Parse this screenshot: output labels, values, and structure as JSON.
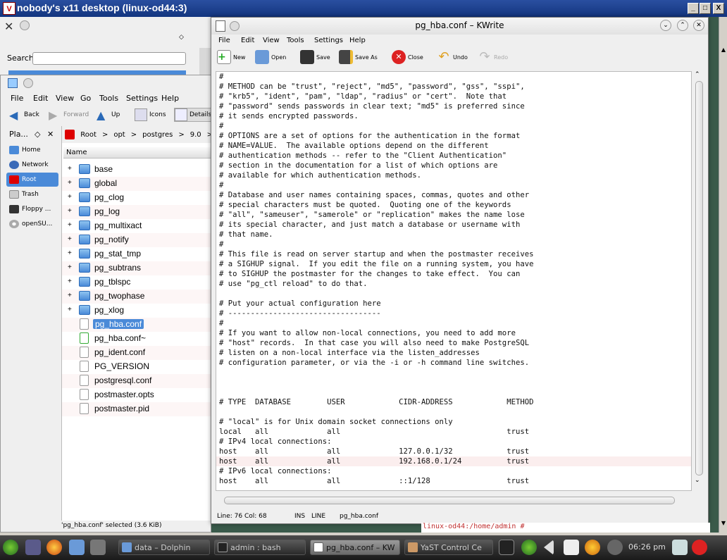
{
  "vnc": {
    "title": "nobody's x11 desktop (linux-od44:3)",
    "logo": "V",
    "minimize": "_",
    "maximize": "□",
    "close": "X"
  },
  "back_window": {
    "search_label": "Search",
    "search_value": ""
  },
  "dolphin": {
    "menu": [
      "File",
      "Edit",
      "View",
      "Go",
      "Tools",
      "Settings",
      "Help"
    ],
    "toolbar": {
      "back": "Back",
      "forward": "Forward",
      "up": "Up",
      "icons": "Icons",
      "details": "Details"
    },
    "places_title": "Pla...",
    "places": [
      {
        "label": "Home",
        "icon": "home-icon"
      },
      {
        "label": "Network",
        "icon": "network-icon"
      },
      {
        "label": "Root",
        "icon": "root-folder-icon",
        "selected": true
      },
      {
        "label": "Trash",
        "icon": "trash-icon"
      },
      {
        "label": "Floppy ...",
        "icon": "floppy-icon"
      },
      {
        "label": "openSU...",
        "icon": "disc-icon"
      }
    ],
    "breadcrumb": [
      "Root",
      "opt",
      "postgres",
      "9.0"
    ],
    "column_header": "Name",
    "files": [
      {
        "name": "base",
        "type": "folder",
        "expand": "+"
      },
      {
        "name": "global",
        "type": "folder",
        "expand": "+"
      },
      {
        "name": "pg_clog",
        "type": "folder",
        "expand": "+"
      },
      {
        "name": "pg_log",
        "type": "folder",
        "expand": "+"
      },
      {
        "name": "pg_multixact",
        "type": "folder",
        "expand": "+"
      },
      {
        "name": "pg_notify",
        "type": "folder",
        "expand": "+"
      },
      {
        "name": "pg_stat_tmp",
        "type": "folder",
        "expand": "+"
      },
      {
        "name": "pg_subtrans",
        "type": "folder",
        "expand": "+"
      },
      {
        "name": "pg_tblspc",
        "type": "folder",
        "expand": "+"
      },
      {
        "name": "pg_twophase",
        "type": "folder",
        "expand": "+"
      },
      {
        "name": "pg_xlog",
        "type": "folder",
        "expand": "+"
      },
      {
        "name": "pg_hba.conf",
        "type": "doc",
        "expand": "",
        "selected": true
      },
      {
        "name": "pg_hba.conf~",
        "type": "doc2",
        "expand": ""
      },
      {
        "name": "pg_ident.conf",
        "type": "doc",
        "expand": ""
      },
      {
        "name": "PG_VERSION",
        "type": "doc",
        "expand": ""
      },
      {
        "name": "postgresql.conf",
        "type": "doc",
        "expand": ""
      },
      {
        "name": "postmaster.opts",
        "type": "doc",
        "expand": ""
      },
      {
        "name": "postmaster.pid",
        "type": "doc",
        "expand": ""
      }
    ],
    "status": "'pg_hba.conf' selected (3.6 KiB)"
  },
  "kwrite": {
    "title": "pg_hba.conf – KWrite",
    "menu": [
      "File",
      "Edit",
      "View",
      "Tools",
      "Settings",
      "Help"
    ],
    "toolbar": {
      "new": "New",
      "open": "Open",
      "save": "Save",
      "save_as": "Save As",
      "close": "Close",
      "undo": "Undo",
      "redo": "Redo"
    },
    "content": "#\n# METHOD can be \"trust\", \"reject\", \"md5\", \"password\", \"gss\", \"sspi\",\n# \"krb5\", \"ident\", \"pam\", \"ldap\", \"radius\" or \"cert\".  Note that\n# \"password\" sends passwords in clear text; \"md5\" is preferred since\n# it sends encrypted passwords.\n#\n# OPTIONS are a set of options for the authentication in the format\n# NAME=VALUE.  The available options depend on the different\n# authentication methods -- refer to the \"Client Authentication\"\n# section in the documentation for a list of which options are\n# available for which authentication methods.\n#\n# Database and user names containing spaces, commas, quotes and other\n# special characters must be quoted.  Quoting one of the keywords\n# \"all\", \"sameuser\", \"samerole\" or \"replication\" makes the name lose\n# its special character, and just match a database or username with\n# that name.\n#\n# This file is read on server startup and when the postmaster receives\n# a SIGHUP signal.  If you edit the file on a running system, you have\n# to SIGHUP the postmaster for the changes to take effect.  You can\n# use \"pg_ctl reload\" to do that.\n\n# Put your actual configuration here\n# ----------------------------------\n#\n# If you want to allow non-local connections, you need to add more\n# \"host\" records.  In that case you will also need to make PostgreSQL\n# listen on a non-local interface via the listen_addresses\n# configuration parameter, or via the -i or -h command line switches.\n\n\n\n# TYPE  DATABASE        USER            CIDR-ADDRESS            METHOD\n\n# \"local\" is for Unix domain socket connections only\nlocal   all             all                                     trust\n# IPv4 local connections:\nhost    all             all             127.0.0.1/32            trust\nhost    all             all             192.168.0.1/24          trust\n# IPv6 local connections:\nhost    all             all             ::1/128                 trust",
    "status": {
      "position": "Line: 76 Col: 68",
      "mode": "INS",
      "wrap": "LINE",
      "filename": "pg_hba.conf"
    }
  },
  "terminal_peek": "linux-od44:/home/admin # ",
  "taskbar": {
    "tasks": [
      {
        "label": "data – Dolphin",
        "icon": "dolphin-icon"
      },
      {
        "label": "admin : bash",
        "icon": "terminal-icon"
      },
      {
        "label": "pg_hba.conf – KW",
        "icon": "kwrite-icon",
        "active": true
      },
      {
        "label": "YaST Control Ce",
        "icon": "yast-icon"
      }
    ],
    "clock": "06:26 pm"
  }
}
